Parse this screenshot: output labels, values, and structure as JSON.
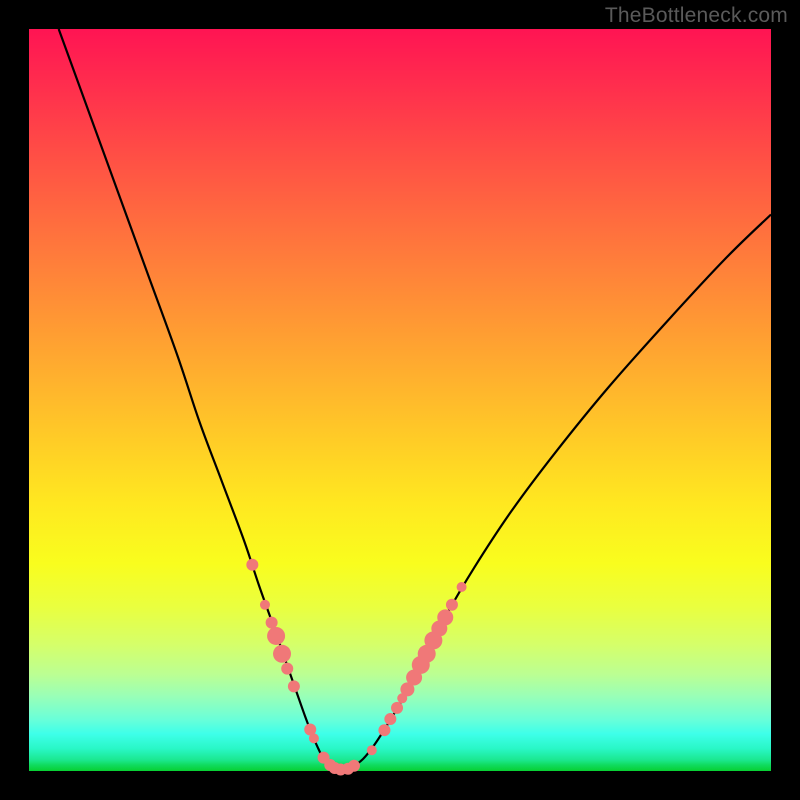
{
  "watermark": "TheBottleneck.com",
  "colors": {
    "frame": "#000000",
    "curve": "#000000",
    "marker": "#f07878",
    "marker_stroke": "#e86b6b"
  },
  "chart_data": {
    "type": "line",
    "title": "",
    "xlabel": "",
    "ylabel": "",
    "xlim": [
      0,
      100
    ],
    "ylim": [
      0,
      100
    ],
    "annotations": [],
    "series": [
      {
        "name": "left-curve",
        "x": [
          4,
          8,
          12,
          16,
          20,
          23,
          26,
          29,
          31,
          33,
          34.6,
          36,
          37.2,
          38.2,
          39,
          39.6,
          40.2,
          41,
          42
        ],
        "y": [
          100,
          89,
          78,
          67,
          56,
          47,
          39,
          31,
          25,
          19.4,
          14.8,
          10.8,
          7.4,
          4.8,
          3.0,
          1.8,
          1.0,
          0.4,
          0.15
        ]
      },
      {
        "name": "right-curve",
        "x": [
          42,
          43.4,
          45,
          46.6,
          48.4,
          50.4,
          53,
          56,
          60,
          65,
          71,
          78,
          86,
          94,
          100
        ],
        "y": [
          0.15,
          0.5,
          1.6,
          3.6,
          6.4,
          9.8,
          14.8,
          20.6,
          27.4,
          35,
          43,
          51.6,
          60.6,
          69.2,
          75
        ]
      }
    ],
    "markers": [
      {
        "x": 30.1,
        "y": 27.8,
        "r": 6
      },
      {
        "x": 31.8,
        "y": 22.4,
        "r": 5
      },
      {
        "x": 32.7,
        "y": 20.0,
        "r": 6
      },
      {
        "x": 33.3,
        "y": 18.2,
        "r": 9
      },
      {
        "x": 34.1,
        "y": 15.8,
        "r": 9
      },
      {
        "x": 34.8,
        "y": 13.8,
        "r": 6
      },
      {
        "x": 35.7,
        "y": 11.4,
        "r": 6
      },
      {
        "x": 37.9,
        "y": 5.6,
        "r": 6
      },
      {
        "x": 38.4,
        "y": 4.4,
        "r": 5
      },
      {
        "x": 39.7,
        "y": 1.8,
        "r": 6
      },
      {
        "x": 40.6,
        "y": 0.8,
        "r": 6
      },
      {
        "x": 41.2,
        "y": 0.4,
        "r": 6
      },
      {
        "x": 42.0,
        "y": 0.2,
        "r": 6
      },
      {
        "x": 43.0,
        "y": 0.3,
        "r": 6
      },
      {
        "x": 43.8,
        "y": 0.7,
        "r": 6
      },
      {
        "x": 46.2,
        "y": 2.8,
        "r": 5
      },
      {
        "x": 47.9,
        "y": 5.5,
        "r": 6
      },
      {
        "x": 48.7,
        "y": 7.0,
        "r": 6
      },
      {
        "x": 49.6,
        "y": 8.5,
        "r": 6
      },
      {
        "x": 50.3,
        "y": 9.8,
        "r": 5
      },
      {
        "x": 51.0,
        "y": 11.0,
        "r": 7
      },
      {
        "x": 51.9,
        "y": 12.6,
        "r": 8
      },
      {
        "x": 52.8,
        "y": 14.3,
        "r": 9
      },
      {
        "x": 53.6,
        "y": 15.8,
        "r": 9
      },
      {
        "x": 54.5,
        "y": 17.6,
        "r": 9
      },
      {
        "x": 55.3,
        "y": 19.2,
        "r": 8
      },
      {
        "x": 56.1,
        "y": 20.7,
        "r": 8
      },
      {
        "x": 57.0,
        "y": 22.4,
        "r": 6
      },
      {
        "x": 58.3,
        "y": 24.8,
        "r": 5
      }
    ]
  }
}
